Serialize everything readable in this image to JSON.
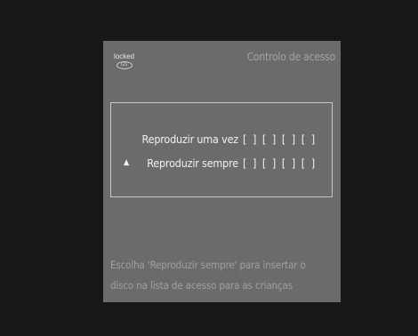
{
  "status": {
    "locked_label": "locked",
    "badge_label": "GS"
  },
  "screen": {
    "title": "Controlo de acesso"
  },
  "options": [
    {
      "label": "Reproduzir uma vez",
      "code": "[ ] [ ] [ ] [ ]",
      "selected": false,
      "marker": ""
    },
    {
      "label": "Reproduzir sempre",
      "code": "[ ] [ ] [ ] [ ]",
      "selected": true,
      "marker": "▲"
    }
  ],
  "help": {
    "line1": "Escolha 'Reproduzir sempre' para insertar o",
    "line2": "disco na lista de acesso para as crianças"
  },
  "colors": {
    "background": "#171717",
    "screen": "#6b6b6b",
    "text_primary": "#f0f0f0",
    "text_muted": "#a2a2a2"
  }
}
